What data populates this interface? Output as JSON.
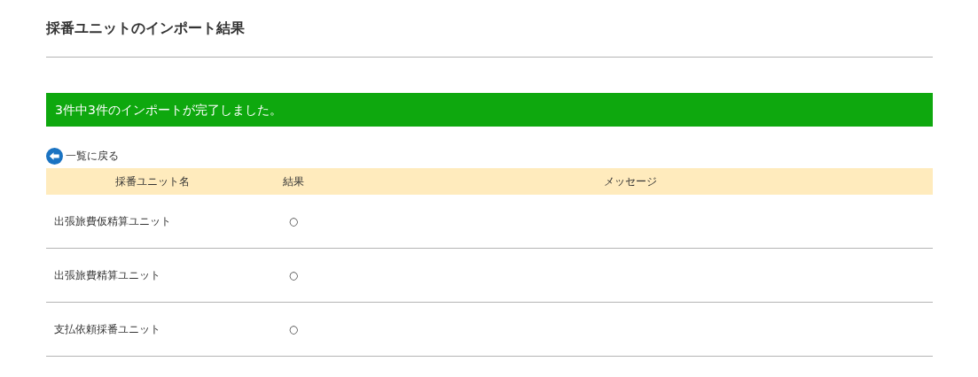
{
  "page": {
    "title": "採番ユニットのインポート結果"
  },
  "banner": {
    "message": "3件中3件のインポートが完了しました。"
  },
  "back_link": {
    "label": "一覧に戻る"
  },
  "table": {
    "columns": [
      "採番ユニット名",
      "結果",
      "メッセージ"
    ],
    "rows": [
      {
        "name": "出張旅費仮精算ユニット",
        "result": "○"
      },
      {
        "name": "出張旅費精算ユニット",
        "result": "○"
      },
      {
        "name": "支払依頼採番ユニット",
        "result": "○"
      }
    ]
  }
}
